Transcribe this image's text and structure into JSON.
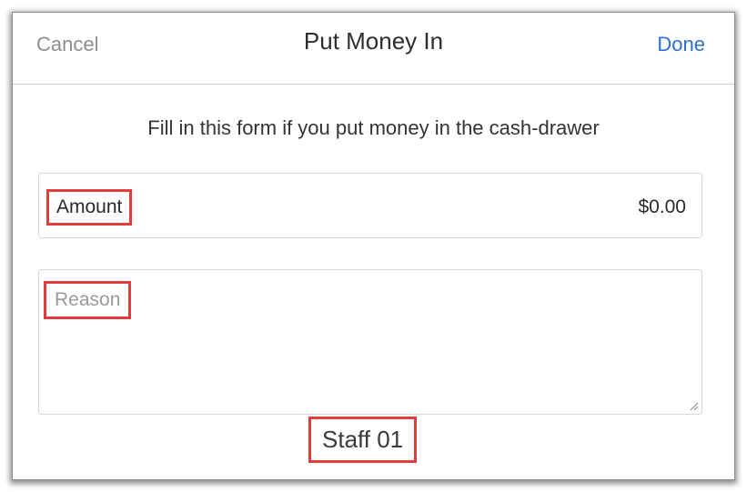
{
  "header": {
    "cancel_label": "Cancel",
    "title": "Put Money In",
    "done_label": "Done"
  },
  "form": {
    "instruction": "Fill in this form if you put money in the cash-drawer",
    "amount": {
      "label": "Amount",
      "value": "$0.00"
    },
    "reason": {
      "placeholder": "Reason",
      "value": ""
    }
  },
  "footer": {
    "staff_name": "Staff 01"
  },
  "colors": {
    "accent": "#2d6fd2",
    "highlight": "#e53b3b",
    "muted": "#8e8e8e"
  }
}
